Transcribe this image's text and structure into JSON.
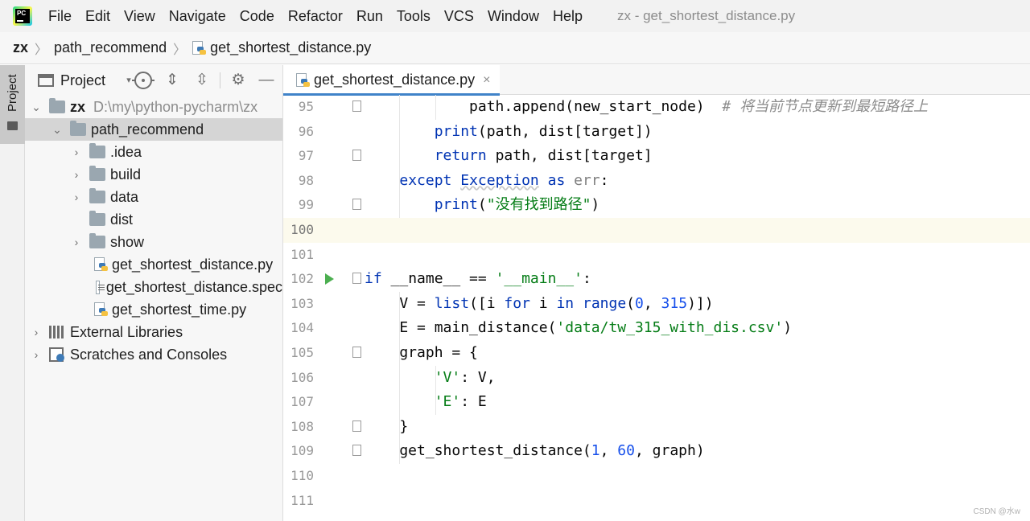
{
  "menubar": {
    "logo_text": "PC",
    "items": [
      "File",
      "Edit",
      "View",
      "Navigate",
      "Code",
      "Refactor",
      "Run",
      "Tools",
      "VCS",
      "Window",
      "Help"
    ],
    "window_title": "zx - get_shortest_distance.py"
  },
  "breadcrumb": {
    "root": "zx",
    "folder": "path_recommend",
    "file": "get_shortest_distance.py",
    "file_icon": "python-file-icon"
  },
  "tool_strip": {
    "project_tab_label": "Project"
  },
  "project_panel": {
    "title": "Project",
    "tools": [
      "locate-icon",
      "expand-all-icon",
      "collapse-all-icon",
      "gear-icon",
      "hide-icon"
    ],
    "tree": [
      {
        "label": "zx",
        "path": "D:\\my\\python-pycharm\\zx",
        "type": "folder",
        "expanded": true,
        "depth": 0
      },
      {
        "label": "path_recommend",
        "type": "folder",
        "expanded": true,
        "depth": 1,
        "selected": true
      },
      {
        "label": ".idea",
        "type": "folder",
        "expanded": false,
        "depth": 2
      },
      {
        "label": "build",
        "type": "folder",
        "expanded": false,
        "depth": 2
      },
      {
        "label": "data",
        "type": "folder",
        "expanded": false,
        "depth": 2
      },
      {
        "label": "dist",
        "type": "folder",
        "expanded": null,
        "depth": 2
      },
      {
        "label": "show",
        "type": "folder",
        "expanded": false,
        "depth": 2
      },
      {
        "label": "get_shortest_distance.py",
        "type": "python",
        "depth": 2
      },
      {
        "label": "get_shortest_distance.spec",
        "type": "spec",
        "depth": 2
      },
      {
        "label": "get_shortest_time.py",
        "type": "python",
        "depth": 2
      },
      {
        "label": "External Libraries",
        "type": "library",
        "expanded": false,
        "depth": 0
      },
      {
        "label": "Scratches and Consoles",
        "type": "scratch",
        "expanded": false,
        "depth": 0
      }
    ]
  },
  "editor": {
    "tab_label": "get_shortest_distance.py",
    "tab_close": "×",
    "current_line": "100",
    "lines": [
      {
        "n": "95",
        "tokens": [
          [
            "",
            "            path.append(new_start_node)  "
          ],
          [
            "cmt",
            "# 将当前节点更新到最短路径上"
          ]
        ]
      },
      {
        "n": "96",
        "tokens": [
          [
            "",
            "        "
          ],
          [
            "kw",
            "print"
          ],
          [
            "",
            "(path, dist[target])"
          ]
        ]
      },
      {
        "n": "97",
        "tokens": [
          [
            "",
            "        "
          ],
          [
            "kw",
            "return"
          ],
          [
            "",
            " path, dist[target]"
          ]
        ]
      },
      {
        "n": "98",
        "tokens": [
          [
            "",
            "    "
          ],
          [
            "kw",
            "except"
          ],
          [
            "",
            " "
          ],
          [
            "cls",
            "Exception"
          ],
          [
            "",
            " "
          ],
          [
            "kw",
            "as"
          ],
          [
            "",
            " "
          ],
          [
            "err",
            "err"
          ],
          [
            "",
            ":"
          ]
        ]
      },
      {
        "n": "99",
        "tokens": [
          [
            "",
            "        "
          ],
          [
            "kw",
            "print"
          ],
          [
            "",
            "("
          ],
          [
            "str",
            "\"没有找到路径\""
          ],
          [
            "",
            ")"
          ]
        ]
      },
      {
        "n": "100",
        "tokens": []
      },
      {
        "n": "101",
        "tokens": []
      },
      {
        "n": "102",
        "tokens": [
          [
            "kw",
            "if"
          ],
          [
            "",
            " __name__ == "
          ],
          [
            "str",
            "'__main__'"
          ],
          [
            "",
            ":"
          ]
        ]
      },
      {
        "n": "103",
        "tokens": [
          [
            "",
            "    V = "
          ],
          [
            "kw",
            "list"
          ],
          [
            "",
            "([i "
          ],
          [
            "kw",
            "for"
          ],
          [
            "",
            " i "
          ],
          [
            "kw",
            "in"
          ],
          [
            "",
            " "
          ],
          [
            "kw",
            "range"
          ],
          [
            "",
            "("
          ],
          [
            "num",
            "0"
          ],
          [
            "",
            ", "
          ],
          [
            "num",
            "315"
          ],
          [
            "",
            ")])"
          ]
        ]
      },
      {
        "n": "104",
        "tokens": [
          [
            "",
            "    E = main_distance("
          ],
          [
            "str",
            "'data/tw_315_with_dis.csv'"
          ],
          [
            "",
            ")"
          ]
        ]
      },
      {
        "n": "105",
        "tokens": [
          [
            "",
            "    graph = {"
          ]
        ]
      },
      {
        "n": "106",
        "tokens": [
          [
            "",
            "        "
          ],
          [
            "str",
            "'V'"
          ],
          [
            "",
            ": V,"
          ]
        ]
      },
      {
        "n": "107",
        "tokens": [
          [
            "",
            "        "
          ],
          [
            "str",
            "'E'"
          ],
          [
            "",
            ": E"
          ]
        ]
      },
      {
        "n": "108",
        "tokens": [
          [
            "",
            "    }"
          ]
        ]
      },
      {
        "n": "109",
        "tokens": [
          [
            "",
            "    get_shortest_distance("
          ],
          [
            "num",
            "1"
          ],
          [
            "",
            ", "
          ],
          [
            "num",
            "60"
          ],
          [
            "",
            ", graph)"
          ]
        ]
      },
      {
        "n": "110",
        "tokens": []
      },
      {
        "n": "111",
        "tokens": []
      }
    ],
    "fold_markers": [
      "95",
      "97",
      "99",
      "102",
      "105",
      "108",
      "109"
    ],
    "run_marker_line": "102"
  },
  "watermark": "CSDN @水w",
  "colors": {
    "keyword": "#0033b3",
    "string": "#067d17",
    "number": "#1750eb",
    "comment": "#8c8c8c",
    "current_line": "#fcfaed",
    "selection": "#d5d5d5",
    "tab_underline": "#4083c9"
  }
}
